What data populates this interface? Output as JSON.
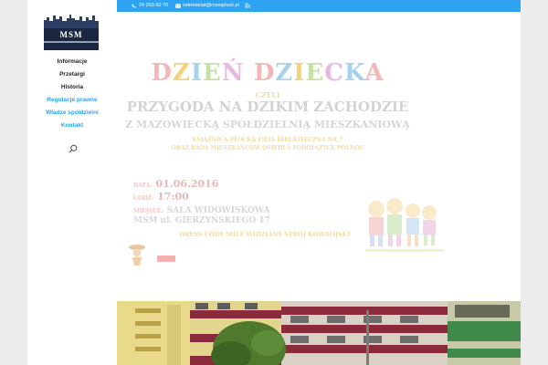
{
  "logo": {
    "text": "MSM"
  },
  "nav": [
    {
      "label": "Informacje",
      "style": "dark"
    },
    {
      "label": "Przetargi",
      "style": "dark"
    },
    {
      "label": "Historia",
      "style": "dark"
    },
    {
      "label": "Regulacje prawne",
      "style": "blue"
    },
    {
      "label": "Władze spółdzielni",
      "style": "blue"
    },
    {
      "label": "Kontakt",
      "style": "blue"
    }
  ],
  "topbar": {
    "phone": "24 263 60 70",
    "email": "sekretariat@msmplock.pl"
  },
  "poster": {
    "title_letters": [
      "D",
      "Z",
      "I",
      "E",
      "Ń",
      " ",
      "D",
      "Z",
      "I",
      "E",
      "C",
      "K",
      "A"
    ],
    "czyli": "CZYLI",
    "przygoda": "PRZYGODA NA DZIKIM ZACHODZIE",
    "zmaz": "Z MAZOWIECKĄ SPÓŁDZIELNIĄ MIESZKANIOWĄ",
    "bib1": "KSIĄŻNICĄ PŁOCKĄ FILIA BIBLIOTECZNA NR.7",
    "bib2": "ORAZ RADĄ MIESZKAŃCÓW OSIEDLA PODOLSZYCE PÓŁNOC",
    "date_label": "DATA:",
    "date_value": "01.06.2016",
    "time_label": "GODZ:",
    "time_value": "17:00",
    "place_label": "MIEJSCE:",
    "place_value1": "SALA WIDOWISKOWA",
    "place_value2": "MSM ul. GIERZYŃSKIEGO 17",
    "slogan": "DRESS CODE MILE WIDZIANY STRÓJ KOWBOJSKI"
  },
  "colors": {
    "accent": "#2ea3f2",
    "nav_dark": "#222222",
    "logo_bg": "#1b2740"
  },
  "icons": [
    "phone-icon",
    "email-icon",
    "rss-icon",
    "search-icon"
  ]
}
